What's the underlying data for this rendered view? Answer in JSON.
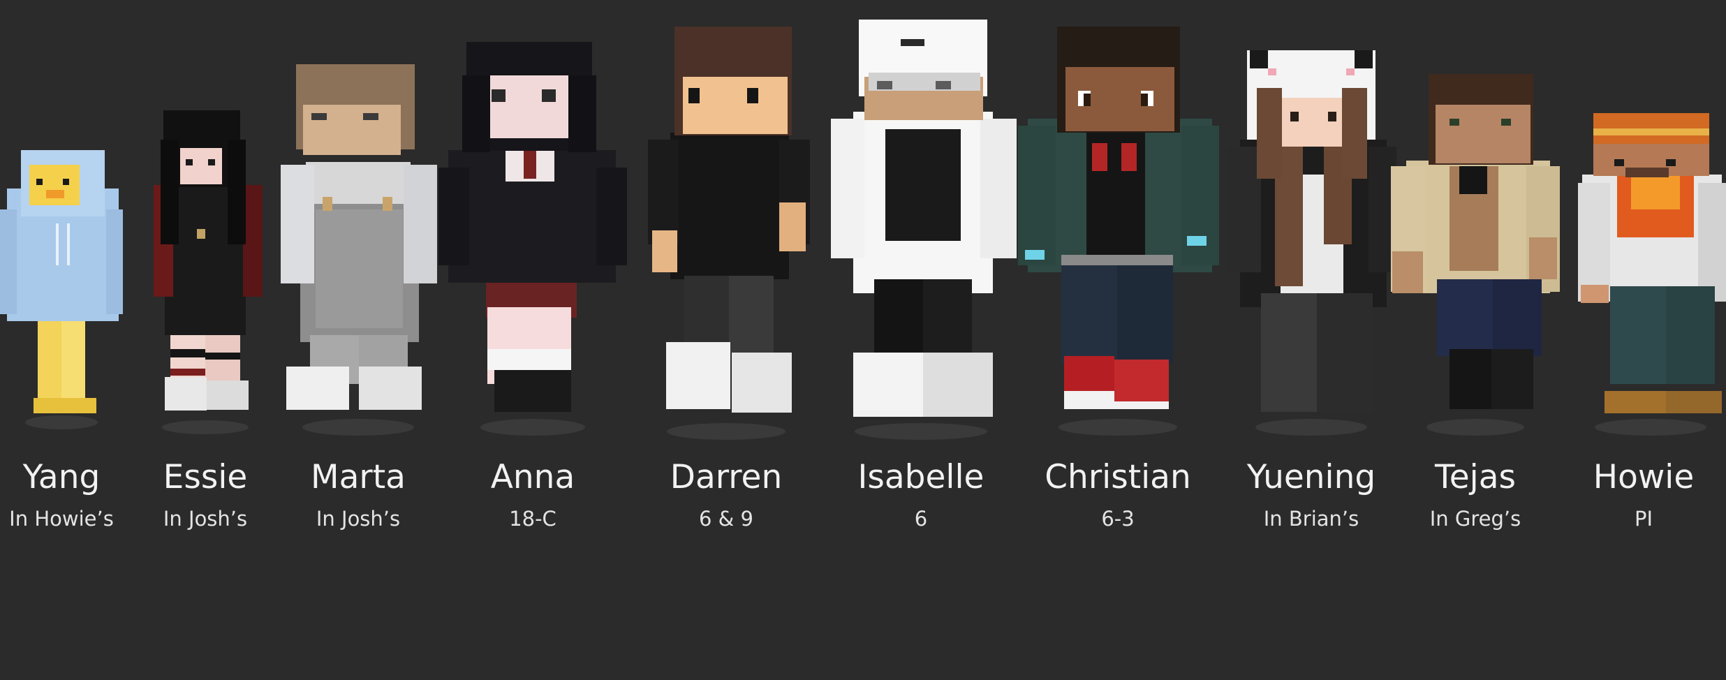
{
  "members": [
    {
      "name": "Yang",
      "location": "In Howie’s"
    },
    {
      "name": "Essie",
      "location": "In Josh’s"
    },
    {
      "name": "Marta",
      "location": "In Josh’s"
    },
    {
      "name": "Anna",
      "location": "18-C"
    },
    {
      "name": "Darren",
      "location": "6 & 9"
    },
    {
      "name": "Isabelle",
      "location": "6"
    },
    {
      "name": "Christian",
      "location": "6-3"
    },
    {
      "name": "Yuening",
      "location": "In Brian’s"
    },
    {
      "name": "Tejas",
      "location": "In Greg’s"
    },
    {
      "name": "Howie",
      "location": "PI"
    }
  ],
  "colors": {
    "background": "#2b2b2b",
    "name_text": "#f2f2f2",
    "location_text": "#e4e4e4"
  }
}
